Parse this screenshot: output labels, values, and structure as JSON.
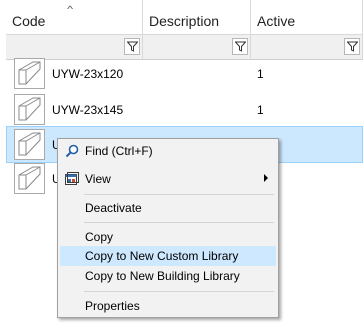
{
  "grid": {
    "columns": [
      {
        "label": "Code",
        "sorted": "ascending"
      },
      {
        "label": "Description"
      },
      {
        "label": "Active"
      }
    ],
    "rows": [
      {
        "code": "UYW-23x120",
        "description": "",
        "active": "1",
        "selected": false
      },
      {
        "code": "UYW-23x145",
        "description": "",
        "active": "1",
        "selected": false
      },
      {
        "code": "U",
        "description": "",
        "active": "",
        "selected": true
      },
      {
        "code": "U",
        "description": "",
        "active": "",
        "selected": false
      }
    ]
  },
  "context_menu": {
    "items": [
      {
        "label": "Find (Ctrl+F)",
        "icon": "search-icon"
      },
      {
        "label": "View",
        "icon": "view-icon",
        "submenu": true
      },
      {
        "label": "Deactivate"
      },
      {
        "label": "Copy"
      },
      {
        "label": "Copy to New Custom Library",
        "highlighted": true
      },
      {
        "label": "Copy to New Building Library"
      },
      {
        "label": "Properties"
      }
    ]
  },
  "colors": {
    "selection": "#cce8ff",
    "selection_border": "#99d1ff",
    "menu_highlight": "#cde8ff"
  }
}
